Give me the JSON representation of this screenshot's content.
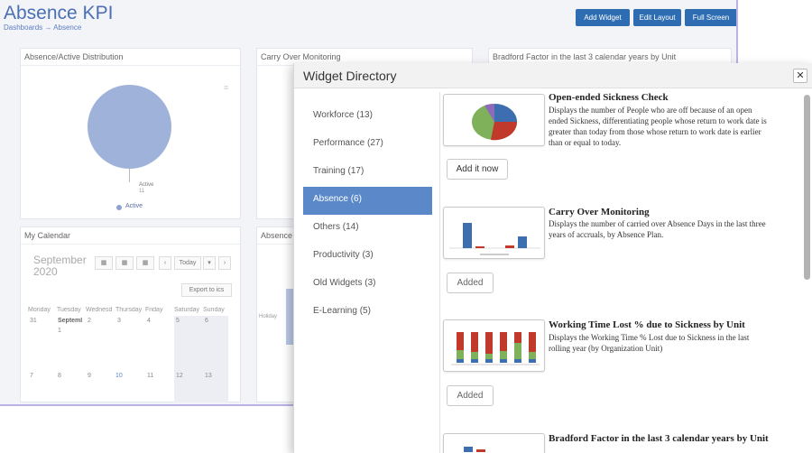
{
  "dashboard": {
    "title": "Absence KPI",
    "breadcrumb": [
      "Dashboards",
      "→",
      "Absence"
    ],
    "buttons": {
      "add_widget": "Add Widget",
      "edit_layout": "Edit Layout",
      "full_screen": "Full Screen"
    },
    "panels": {
      "absence_distribution": "Absence/Active Distribution",
      "carry_over": "Carry Over Monitoring",
      "bradford": "Bradford Factor in the last 3 calendar years by Unit",
      "calendar": "My Calendar",
      "absence_b": "Absence F"
    },
    "pie": {
      "slice_label": "Active",
      "slice_value": "11",
      "legend": "Active",
      "color": "#9fb2da"
    },
    "side_label": "Holiday",
    "calendar": {
      "month": "September",
      "year": "2020",
      "today": "Today",
      "export": "Export to ics",
      "weekdays": [
        "Monday",
        "Tuesday",
        "Wednesd",
        "Thursday",
        "Friday",
        "Saturday",
        "Sunday"
      ],
      "row1": [
        "31",
        "Septeml",
        "2",
        "3",
        "4",
        "5",
        "6"
      ],
      "row1_sub": "1",
      "row2": [
        "7",
        "8",
        "9",
        "10",
        "11",
        "12",
        "13"
      ]
    }
  },
  "modal": {
    "title": "Widget Directory",
    "close_icon": "close-icon",
    "categories": [
      {
        "label": "Workforce (13)",
        "active": false
      },
      {
        "label": "Performance (27)",
        "active": false
      },
      {
        "label": "Training (17)",
        "active": false
      },
      {
        "label": "Absence (6)",
        "active": true
      },
      {
        "label": "Others (14)",
        "active": false
      },
      {
        "label": "Productivity (3)",
        "active": false
      },
      {
        "label": "Old Widgets (3)",
        "active": false
      },
      {
        "label": "E-Learning (5)",
        "active": false
      }
    ],
    "widgets": [
      {
        "title": "Open-ended Sickness Check",
        "description": "Displays the number of People who are off because of an open ended Sickness, differentiating people whose return to work date is greater than today from those whose return to work date is earlier than or equal to today.",
        "button": "Add it now"
      },
      {
        "title": "Carry Over Monitoring",
        "description": "Displays the number of carried over Absence Days in the last three years of accruals, by Absence Plan.",
        "button": "Added"
      },
      {
        "title": "Working Time Lost % due to Sickness by Unit",
        "description": "Displays the Working Time % Lost due to Sickness in the last rolling year (by Organization Unit)",
        "button": "Added"
      },
      {
        "title": "Bradford Factor in the last 3 calendar years by Unit",
        "description": "",
        "button": ""
      }
    ]
  },
  "colors": {
    "accent": "#2f6db2",
    "active_category": "#5b88c9",
    "title_blue": "#4a6fb5"
  }
}
